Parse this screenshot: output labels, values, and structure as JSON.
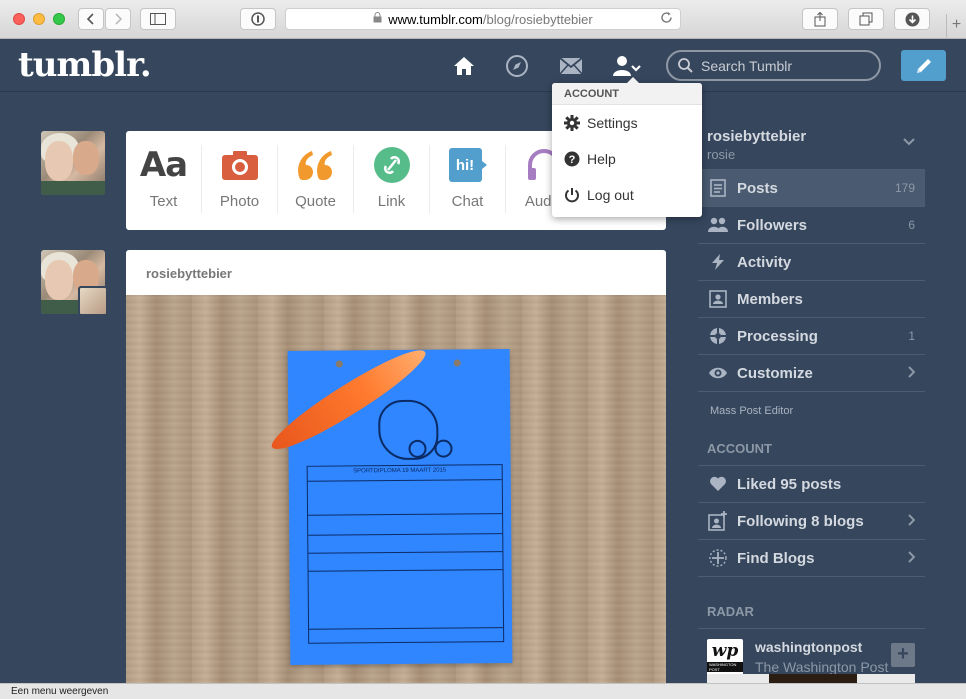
{
  "browser": {
    "url_domain": "www.tumblr.com",
    "url_path": "/blog/rosiebyttebier",
    "status_text": "Een menu weergeven"
  },
  "header": {
    "logo": "tumblr.",
    "search_placeholder": "Search Tumblr"
  },
  "post_types": [
    {
      "label": "Text",
      "icon": "text-icon",
      "color": "#444444"
    },
    {
      "label": "Photo",
      "icon": "camera-icon",
      "color": "#d95e40"
    },
    {
      "label": "Quote",
      "icon": "quote-icon",
      "color": "#f2992e"
    },
    {
      "label": "Link",
      "icon": "link-icon",
      "color": "#56bc8a"
    },
    {
      "label": "Chat",
      "icon": "chat-icon",
      "color": "#529ecc"
    },
    {
      "label": "Audio",
      "icon": "headphones-icon",
      "color": "#a77dc2"
    }
  ],
  "post": {
    "author": "rosiebyttebier",
    "paper_title": "SPORTDIPLOMA 19 MAART 2015"
  },
  "dropdown": {
    "header": "ACCOUNT",
    "items": [
      "Settings",
      "Help",
      "Log out"
    ]
  },
  "sidebar": {
    "blog_name": "rosiebyttebier",
    "blog_title": "rosie",
    "items": [
      {
        "label": "Posts",
        "count": "179"
      },
      {
        "label": "Followers",
        "count": "6"
      },
      {
        "label": "Activity",
        "count": ""
      },
      {
        "label": "Members",
        "count": ""
      },
      {
        "label": "Processing",
        "count": "1"
      },
      {
        "label": "Customize",
        "count": ""
      }
    ],
    "mass_post_editor": "Mass Post Editor",
    "account_header": "ACCOUNT",
    "account_items": [
      {
        "label": "Liked 95 posts"
      },
      {
        "label": "Following 8 blogs"
      },
      {
        "label": "Find Blogs"
      }
    ],
    "radar_header": "RADAR",
    "radar": {
      "name": "washingtonpost",
      "title": "The Washington Post",
      "logo_text": "wp",
      "logo_sub": "WASHINGTON POST"
    }
  },
  "colors": {
    "background": "#36465d",
    "accent": "#529ecc"
  }
}
